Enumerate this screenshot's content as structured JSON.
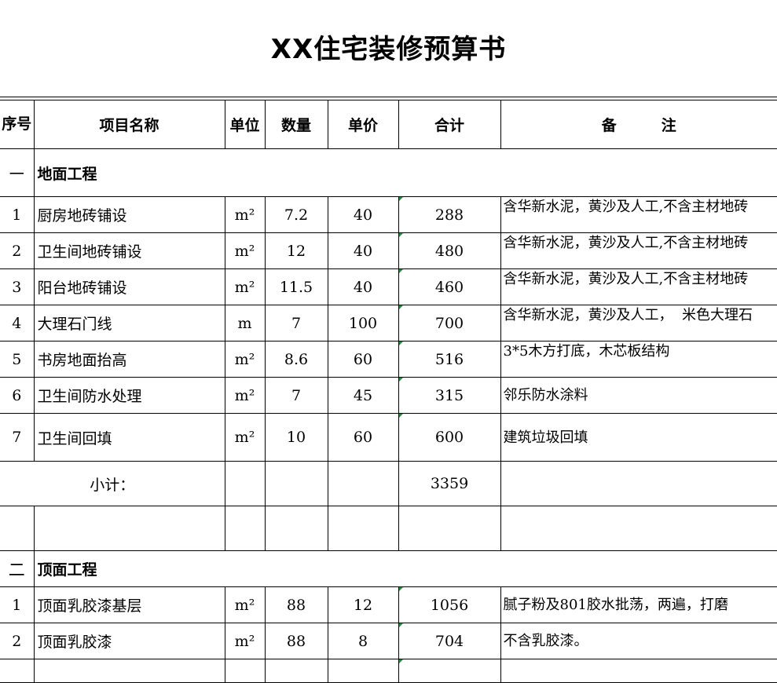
{
  "title": "XX住宅装修预算书",
  "columns": {
    "seq": "序号",
    "name": "项目名称",
    "unit": "单位",
    "qty": "数量",
    "price": "单价",
    "total": "合计",
    "note": "备　　　注"
  },
  "section1": {
    "num": "一",
    "title": "地面工程",
    "rows": [
      {
        "seq": "1",
        "name": "厨房地砖铺设",
        "unit": "m²",
        "qty": "7.2",
        "price": "40",
        "total": "288",
        "note": "含华新水泥，黄沙及人工,不含主材地砖"
      },
      {
        "seq": "2",
        "name": "卫生间地砖铺设",
        "unit": "m²",
        "qty": "12",
        "price": "40",
        "total": "480",
        "note": "含华新水泥，黄沙及人工,不含主材地砖"
      },
      {
        "seq": "3",
        "name": "阳台地砖铺设",
        "unit": "m²",
        "qty": "11.5",
        "price": "40",
        "total": "460",
        "note": "含华新水泥，黄沙及人工,不含主材地砖"
      },
      {
        "seq": "4",
        "name": "大理石门线",
        "unit": "m",
        "qty": "7",
        "price": "100",
        "total": "700",
        "note": "含华新水泥，黄沙及人工，  米色大理石"
      },
      {
        "seq": "5",
        "name": "书房地面抬高",
        "unit": "m²",
        "qty": "8.6",
        "price": "60",
        "total": "516",
        "note": "3*5木方打底，木芯板结构"
      },
      {
        "seq": "6",
        "name": "卫生间防水处理",
        "unit": "m²",
        "qty": "7",
        "price": "45",
        "total": "315",
        "note": "邻乐防水涂料"
      },
      {
        "seq": "7",
        "name": "卫生间回填",
        "unit": "m²",
        "qty": "10",
        "price": "60",
        "total": "600",
        "note": "建筑垃圾回填"
      }
    ],
    "subtotal_label": "小计：",
    "subtotal_value": "3359"
  },
  "section2": {
    "num": "二",
    "title": "顶面工程",
    "rows": [
      {
        "seq": "1",
        "name": "顶面乳胶漆基层",
        "unit": "m²",
        "qty": "88",
        "price": "12",
        "total": "1056",
        "note": "腻子粉及801胶水批荡，两遍，打磨"
      },
      {
        "seq": "2",
        "name": "顶面乳胶漆",
        "unit": "m²",
        "qty": "88",
        "price": "8",
        "total": "704",
        "note": "不含乳胶漆。"
      }
    ]
  },
  "colors": {
    "grid": "#000000",
    "cell_marker": "#1f8f3a"
  }
}
